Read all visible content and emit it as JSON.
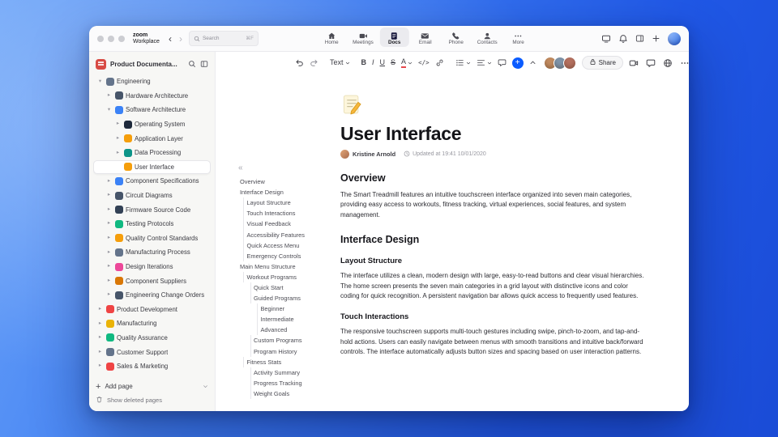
{
  "theme": {
    "accent": "#0b5cff"
  },
  "titlebar": {
    "logo_line1": "zoom",
    "logo_line2": "Workplace",
    "search_placeholder": "Search",
    "search_shortcut": "⌘F",
    "tabs": [
      {
        "label": "Home",
        "icon": "home-icon",
        "active": false
      },
      {
        "label": "Meetings",
        "icon": "meetings-icon",
        "active": false
      },
      {
        "label": "Docs",
        "icon": "docs-icon",
        "active": true
      },
      {
        "label": "Email",
        "icon": "email-icon",
        "active": false
      },
      {
        "label": "Phone",
        "icon": "phone-icon",
        "active": false
      },
      {
        "label": "Contacts",
        "icon": "contacts-icon",
        "active": false
      },
      {
        "label": "More",
        "icon": "more-icon",
        "active": false
      }
    ]
  },
  "sidebar": {
    "title": "Product Documenta...",
    "items": [
      {
        "label": "Engineering",
        "level": 0,
        "chevron": "down",
        "icon": "gear-icon",
        "color": "#64748b"
      },
      {
        "label": "Hardware Architecture",
        "level": 1,
        "chevron": "right",
        "icon": "hardware-icon",
        "color": "#475569"
      },
      {
        "label": "Software Architecture",
        "level": 1,
        "chevron": "down",
        "icon": "software-icon",
        "color": "#3b82f6"
      },
      {
        "label": "Operating System",
        "level": 2,
        "chevron": "right",
        "icon": "os-icon",
        "color": "#1e293b"
      },
      {
        "label": "Application Layer",
        "level": 2,
        "chevron": "right",
        "icon": "app-layer-icon",
        "color": "#f59e0b"
      },
      {
        "label": "Data Processing",
        "level": 2,
        "chevron": "right",
        "icon": "data-icon",
        "color": "#0d9488"
      },
      {
        "label": "User Interface",
        "level": 2,
        "chevron": "none",
        "icon": "pencil-icon",
        "color": "#f59e0b",
        "selected": true
      },
      {
        "label": "Component Specifications",
        "level": 1,
        "chevron": "right",
        "icon": "clipboard-icon",
        "color": "#3b82f6"
      },
      {
        "label": "Circuit Diagrams",
        "level": 1,
        "chevron": "right",
        "icon": "circuit-icon",
        "color": "#475569"
      },
      {
        "label": "Firmware Source Code",
        "level": 1,
        "chevron": "right",
        "icon": "code-file-icon",
        "color": "#334155"
      },
      {
        "label": "Testing Protocols",
        "level": 1,
        "chevron": "right",
        "icon": "flask-icon",
        "color": "#10b981"
      },
      {
        "label": "Quality Control Standards",
        "level": 1,
        "chevron": "right",
        "icon": "quality-icon",
        "color": "#f59e0b"
      },
      {
        "label": "Manufacturing Process",
        "level": 1,
        "chevron": "right",
        "icon": "factory-icon",
        "color": "#64748b"
      },
      {
        "label": "Design Iterations",
        "level": 1,
        "chevron": "right",
        "icon": "palette-icon",
        "color": "#ec4899"
      },
      {
        "label": "Component Suppliers",
        "level": 1,
        "chevron": "right",
        "icon": "suppliers-icon",
        "color": "#d97706"
      },
      {
        "label": "Engineering Change Orders",
        "level": 1,
        "chevron": "right",
        "icon": "change-orders-icon",
        "color": "#475569"
      },
      {
        "label": "Product Development",
        "level": 0,
        "chevron": "right",
        "icon": "product-dev-icon",
        "color": "#ef4444"
      },
      {
        "label": "Manufacturing",
        "level": 0,
        "chevron": "right",
        "icon": "manufacturing-icon",
        "color": "#eab308"
      },
      {
        "label": "Quality Assurance",
        "level": 0,
        "chevron": "right",
        "icon": "qa-icon",
        "color": "#10b981"
      },
      {
        "label": "Customer Support",
        "level": 0,
        "chevron": "right",
        "icon": "support-icon",
        "color": "#64748b"
      },
      {
        "label": "Sales & Marketing",
        "level": 0,
        "chevron": "right",
        "icon": "sales-icon",
        "color": "#ef4444"
      }
    ],
    "add_page": "Add page",
    "show_deleted": "Show deleted pages"
  },
  "doc_toolbar": {
    "text_style": "Text",
    "share": "Share",
    "collaborator_avatars": [
      "#c08a5f",
      "#7e93a8",
      "#b4705f"
    ]
  },
  "outline": [
    {
      "label": "Overview",
      "level": 0
    },
    {
      "label": "Interface Design",
      "level": 0
    },
    {
      "label": "Layout Structure",
      "level": 1
    },
    {
      "label": "Touch Interactions",
      "level": 1
    },
    {
      "label": "Visual Feedback",
      "level": 1
    },
    {
      "label": "Accessibility Features",
      "level": 1
    },
    {
      "label": "Quick Access Menu",
      "level": 1
    },
    {
      "label": "Emergency Controls",
      "level": 1
    },
    {
      "label": "Main Menu Structure",
      "level": 0
    },
    {
      "label": "Workout Programs",
      "level": 1
    },
    {
      "label": "Quick Start",
      "level": 2
    },
    {
      "label": "Guided Programs",
      "level": 2
    },
    {
      "label": "Beginner",
      "level": 3
    },
    {
      "label": "Intermediate",
      "level": 3
    },
    {
      "label": "Advanced",
      "level": 3
    },
    {
      "label": "Custom Programs",
      "level": 2
    },
    {
      "label": "Program History",
      "level": 2
    },
    {
      "label": "Fitness Stats",
      "level": 1
    },
    {
      "label": "Activity Summary",
      "level": 2
    },
    {
      "label": "Progress Tracking",
      "level": 2
    },
    {
      "label": "Weight Goals",
      "level": 2
    }
  ],
  "doc": {
    "title": "User Interface",
    "author": "Kristine Arnold",
    "updated": "Updated at 19:41 10/01/2020",
    "sections": [
      {
        "type": "h2",
        "text": "Overview"
      },
      {
        "type": "p",
        "text": "The Smart Treadmill features an intuitive touchscreen interface organized into seven main categories, providing easy access to workouts, fitness tracking, virtual experiences, social features, and system management."
      },
      {
        "type": "h2",
        "text": "Interface Design"
      },
      {
        "type": "h3",
        "text": "Layout Structure"
      },
      {
        "type": "p",
        "text": "The interface utilizes a clean, modern design with large, easy-to-read buttons and clear visual hierarchies. The home screen presents the seven main categories in a grid layout with distinctive icons and color coding for quick recognition. A persistent navigation bar allows quick access to frequently used features."
      },
      {
        "type": "h3",
        "text": "Touch Interactions"
      },
      {
        "type": "p",
        "text": "The responsive touchscreen supports multi-touch gestures including swipe, pinch-to-zoom, and tap-and-hold actions. Users can easily navigate between menus with smooth transitions and intuitive back/forward controls. The interface automatically adjusts button sizes and spacing based on user interaction patterns."
      }
    ]
  }
}
